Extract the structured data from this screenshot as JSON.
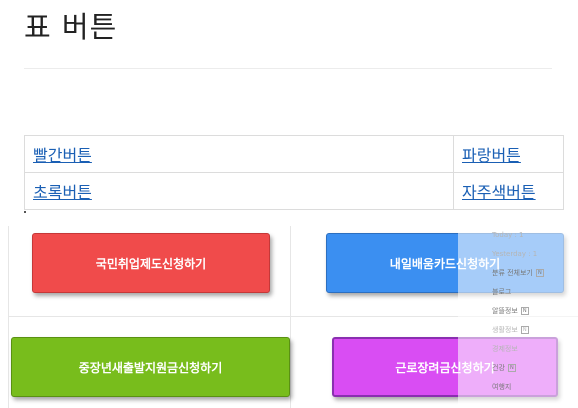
{
  "title": "표 버튼",
  "table": {
    "rows": [
      [
        "빨간버튼",
        "파랑버튼"
      ],
      [
        "초록버튼",
        "자주색버튼"
      ]
    ]
  },
  "buttons": {
    "red": "국민취업제도신청하기",
    "blue": "내일배움카드신청하기",
    "green": "중장년새출발지원금신청하기",
    "purple": "근로장려금신청하기"
  },
  "sidebar": {
    "items": [
      "Today : 1",
      "Yesterday : 1",
      "분류 전체보기",
      "블로그",
      "알뜰정보",
      "생활정보",
      "경제정보",
      "건강",
      "여행지"
    ]
  },
  "colors": {
    "red": "#f04b4b",
    "blue": "#3b8ff1",
    "green": "#78bd1c",
    "purple": "#d94df3"
  }
}
